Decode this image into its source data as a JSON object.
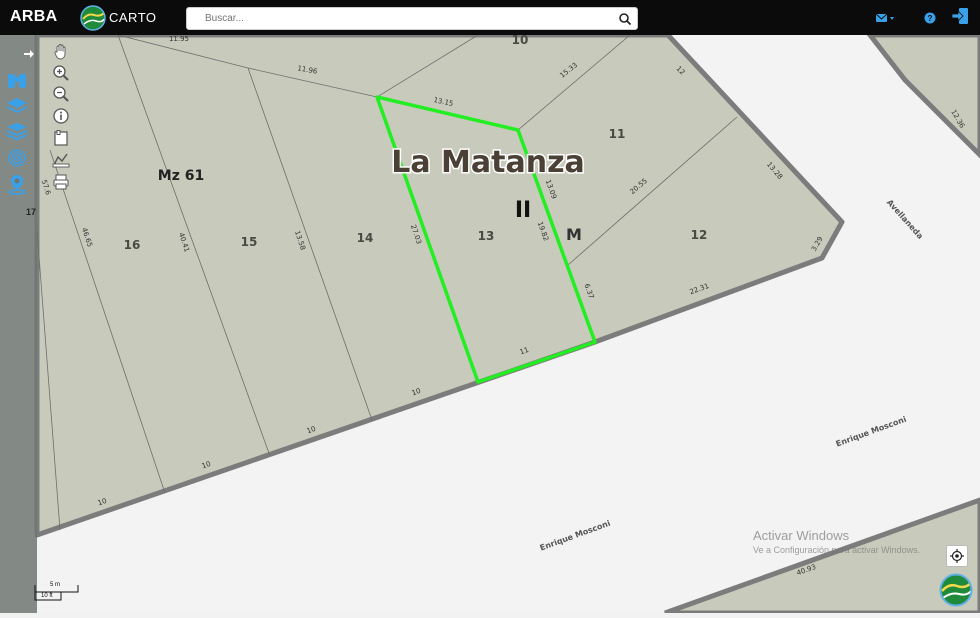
{
  "header": {
    "brand": "ARBA",
    "carto_label": "CARTO",
    "search_placeholder": "Buscar...",
    "icons": [
      "envelope-icon",
      "help-icon",
      "logout-icon"
    ]
  },
  "sidebar": {
    "items": [
      "arrow-right-icon",
      "binoculars-icon",
      "layers-icon",
      "layers-stack-icon",
      "fingerprint-icon",
      "location-icon"
    ]
  },
  "tools": [
    "hand-icon",
    "zoom-in-icon",
    "zoom-out-icon",
    "info-icon",
    "bookmark-icon",
    "measure-icon",
    "print-icon"
  ],
  "map": {
    "locality": "La Matanza",
    "circunscripcion": "II",
    "seccion": "M",
    "manzana": "Mz 61",
    "parcels": [
      "16",
      "15",
      "14",
      "13",
      "11",
      "12",
      "10"
    ],
    "measures": [
      "11.95",
      "11.96",
      "13.15",
      "15.33",
      "12",
      "13.09",
      "19.82",
      "6.37",
      "20.55",
      "13.28",
      "3.29",
      "22.31",
      "27.03",
      "13.58",
      "40.41",
      "46.65",
      "57.6",
      "11",
      "10",
      "10",
      "10",
      "10",
      "40.93",
      "12.36"
    ],
    "streets": [
      "Avellaneda",
      "Enrique Mosconi",
      "Enrique Mosconi"
    ],
    "side_labels": [
      "17"
    ],
    "colors": {
      "parcel_fill": "#c8cabb",
      "selected_outline": "#22ee22",
      "road": "#f3f3f3",
      "block_edge": "#7c7c7c"
    }
  },
  "scale": {
    "metric": "5 m",
    "imperial": "10 ft"
  },
  "watermark": {
    "line1": "Activar Windows",
    "line2": "Ve a Configuración para activar Windows."
  }
}
